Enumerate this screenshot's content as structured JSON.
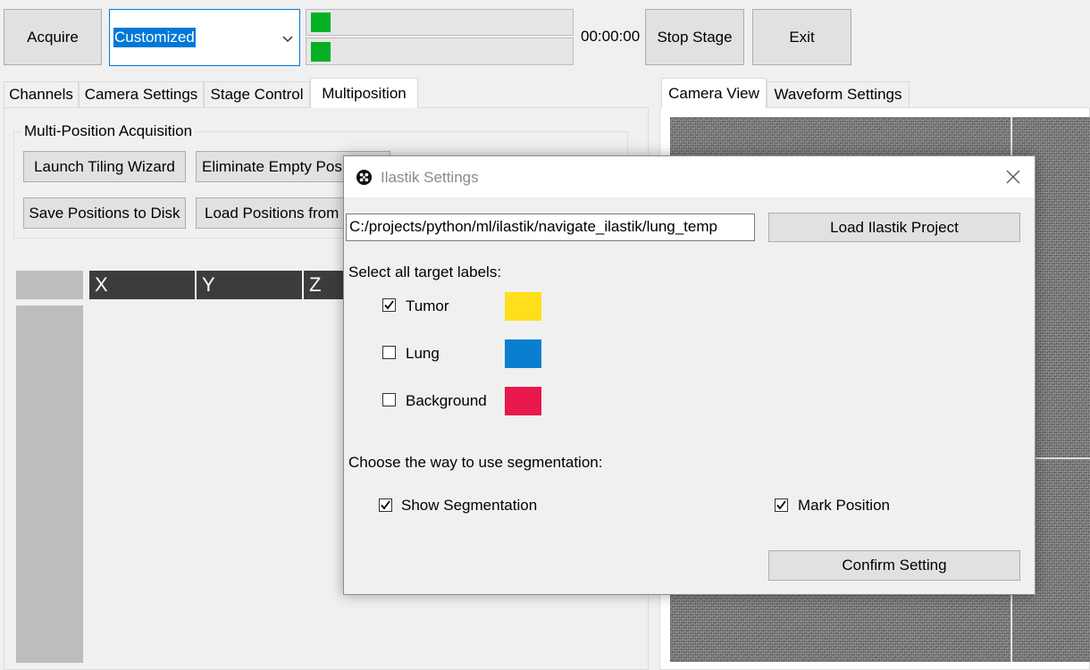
{
  "toolbar": {
    "acquire_label": "Acquire",
    "mode_value": "Customized",
    "timer": "00:00:00",
    "stop_stage_label": "Stop Stage",
    "exit_label": "Exit"
  },
  "left_tabs": [
    "Channels",
    "Camera Settings",
    "Stage Control",
    "Multiposition"
  ],
  "right_tabs": [
    "Camera View",
    "Waveform Settings"
  ],
  "multiposition": {
    "group_title": "Multi-Position Acquisition",
    "launch_tiling_label": "Launch Tiling Wizard",
    "eliminate_empty_label": "Eliminate Empty Positions",
    "save_positions_label": "Save Positions to Disk",
    "load_positions_label": "Load Positions from Disk",
    "table_columns": [
      "X",
      "Y",
      "Z"
    ]
  },
  "dialog": {
    "title": "Ilastik Settings",
    "project_path": "C:/projects/python/ml/ilastik/navigate_ilastik/lung_temp",
    "load_project_label": "Load Ilastik Project",
    "select_labels_heading": "Select all target labels:",
    "labels": [
      {
        "name": "Tumor",
        "checked": true,
        "color": "#ffdf1a"
      },
      {
        "name": "Lung",
        "checked": false,
        "color": "#0a7fcf"
      },
      {
        "name": "Background",
        "checked": false,
        "color": "#e8174c"
      }
    ],
    "segmentation_heading": "Choose the way to use segmentation:",
    "show_segmentation_label": "Show Segmentation",
    "show_segmentation_checked": true,
    "mark_position_label": "Mark Position",
    "mark_position_checked": true,
    "confirm_label": "Confirm Setting"
  }
}
